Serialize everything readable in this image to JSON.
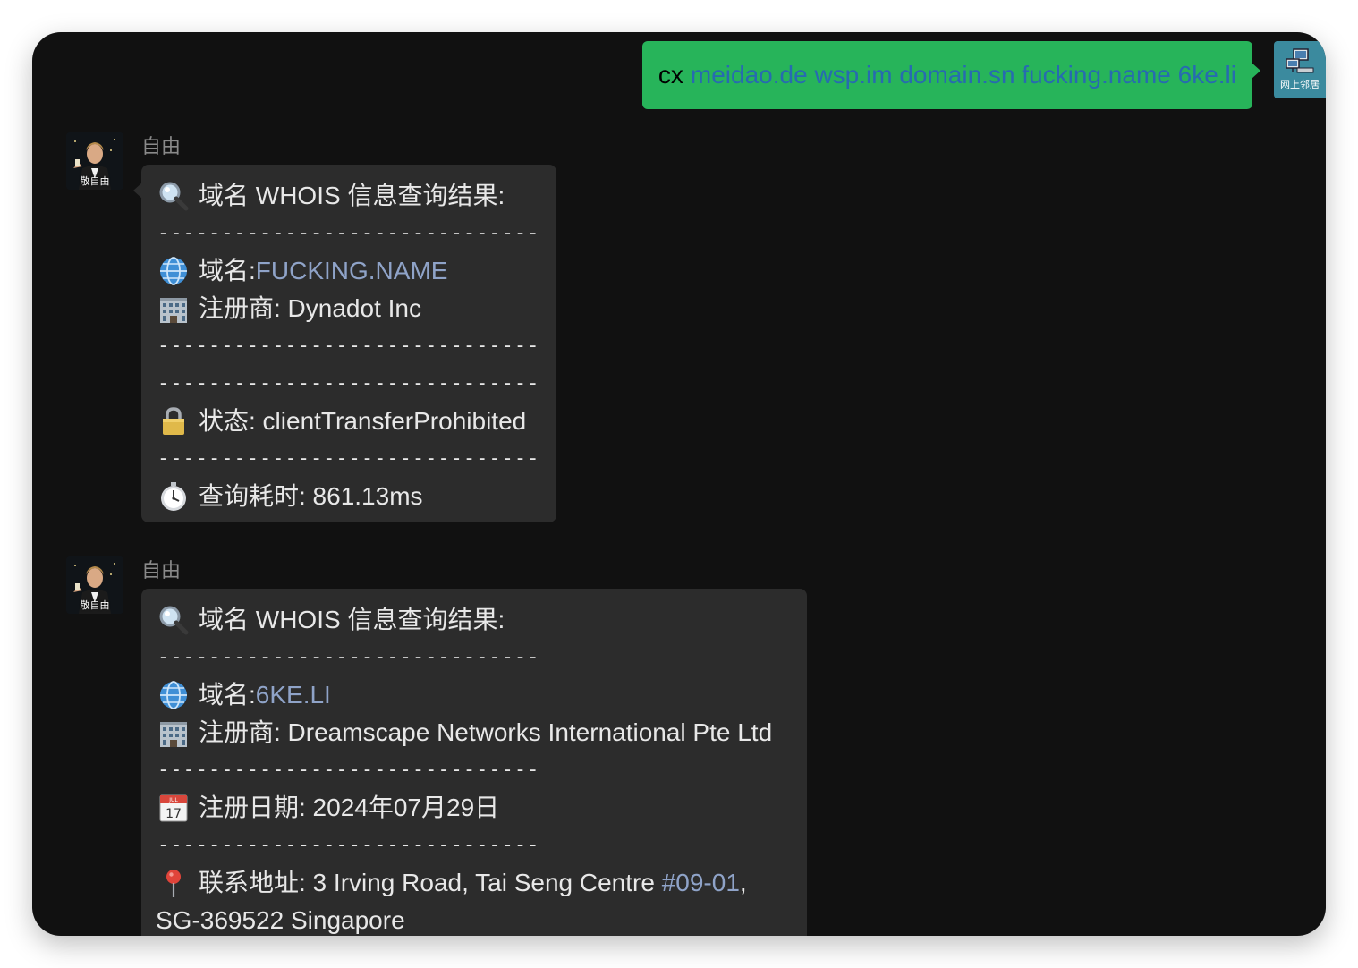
{
  "outgoing": {
    "command": "cx",
    "domains_text": "meidao.de wsp.im domain.sn fucking.name 6ke.li",
    "avatar_caption": "网上邻居"
  },
  "messages": [
    {
      "sender": "自由",
      "avatar_caption": "敬自由",
      "title": "域名 WHOIS 信息查询结果:",
      "separator": "------------------------------",
      "domain_label": "域名: ",
      "domain_value": "FUCKING.NAME",
      "registrar": "注册商: Dynadot Inc",
      "status": "状态: clientTransferProhibited",
      "query_time": "查询耗时: 861.13ms"
    },
    {
      "sender": "自由",
      "avatar_caption": "敬自由",
      "title": "域名 WHOIS 信息查询结果:",
      "separator": "------------------------------",
      "domain_label": "域名: ",
      "domain_value": "6KE.LI",
      "registrar": "注册商: Dreamscape Networks International Pte Ltd",
      "reg_date": "注册日期: 2024年07月29日",
      "address_prefix": "联系地址: 3 Irving Road, Tai Seng Centre ",
      "address_link": "#09-01",
      "address_suffix": ",",
      "address_line2": "SG-369522 Singapore"
    }
  ],
  "colors": {
    "window_bg": "#111111",
    "outgoing_bubble": "#27b45a",
    "incoming_bubble": "#2c2c2c",
    "link": "#8fa3c8"
  }
}
